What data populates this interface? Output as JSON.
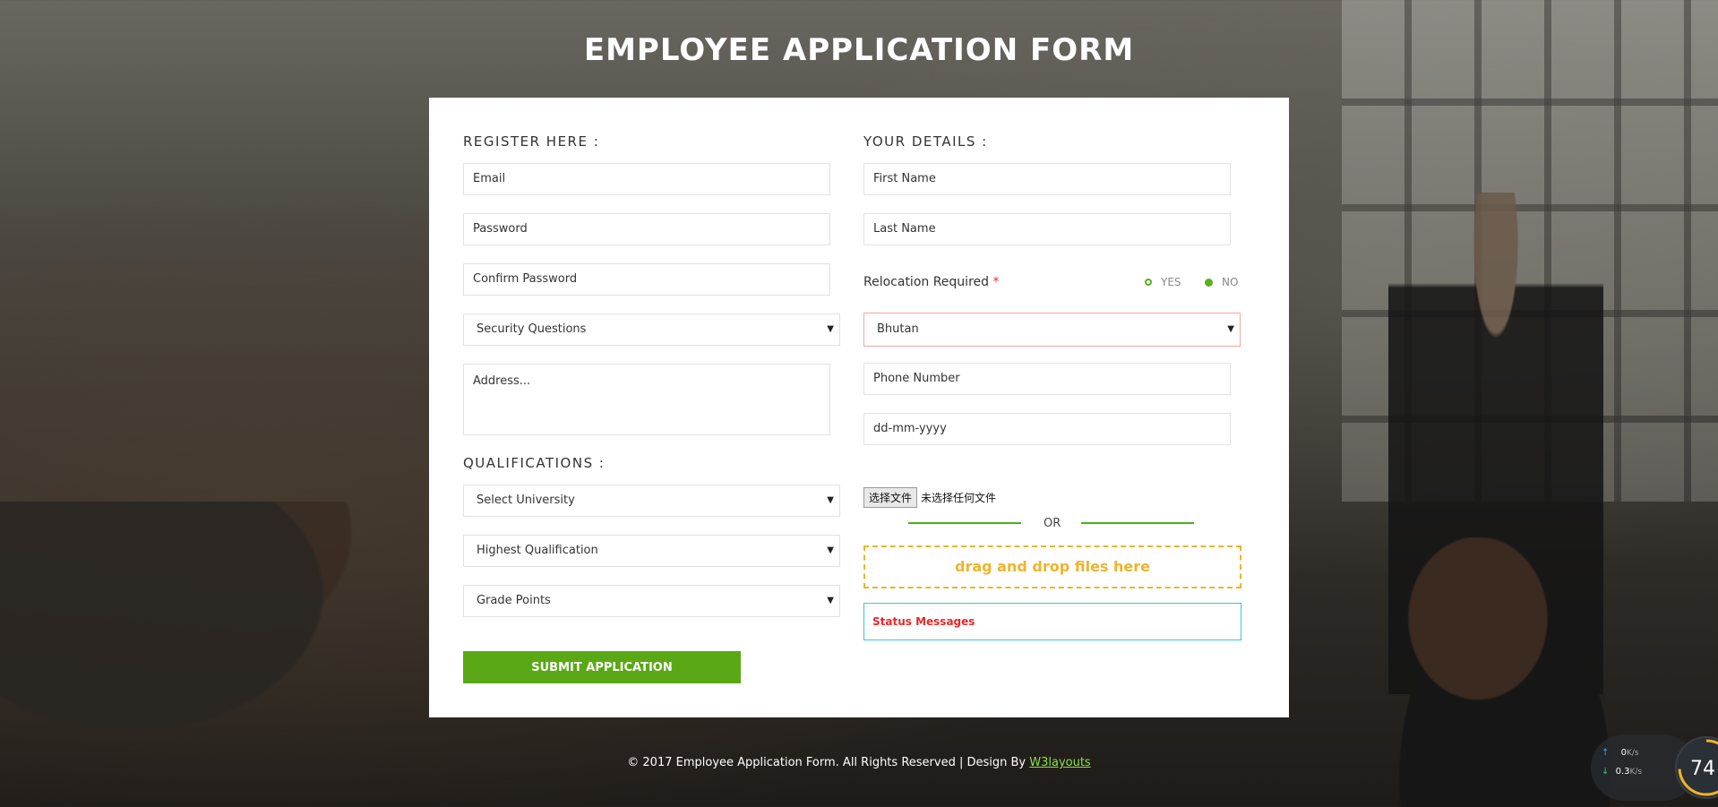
{
  "page": {
    "title": "EMPLOYEE APPLICATION FORM"
  },
  "register": {
    "heading": "REGISTER HERE :",
    "email_placeholder": "Email",
    "password_placeholder": "Password",
    "confirm_password_placeholder": "Confirm Password",
    "security_questions": "Security Questions",
    "address_placeholder": "Address..."
  },
  "qualifications": {
    "heading": "QUALIFICATIONS :",
    "university": "Select University",
    "highest_qualification": "Highest Qualification",
    "grade_points": "Grade Points"
  },
  "details": {
    "heading": "YOUR DETAILS :",
    "first_name_placeholder": "First Name",
    "last_name_placeholder": "Last Name",
    "relocation_label": "Relocation Required",
    "required_mark": "*",
    "relocation_options": [
      "YES",
      "NO"
    ],
    "relocation_selected": "NO",
    "country": "Bhutan",
    "phone_placeholder": "Phone Number",
    "date_placeholder": "dd-mm-yyyy"
  },
  "upload": {
    "button_label": "选择文件",
    "no_file_text": "未选择任何文件",
    "or_text": "OR",
    "dropzone_text": "drag and drop files here",
    "status_text": "Status Messages"
  },
  "submit_label": "SUBMIT APPLICATION",
  "footer": {
    "text": "© 2017 Employee Application Form. All Rights Reserved | Design By ",
    "link_text": "W3layouts"
  },
  "net_monitor": {
    "up_speed": "0",
    "down_speed": "0.3",
    "unit": "K/s",
    "gauge_value": "74",
    "gauge_unit": "%",
    "gauge_percent": 74
  },
  "colors": {
    "accent_green": "#5aa815",
    "dropzone_yellow": "#f0b429",
    "status_red": "#e8272a",
    "status_border": "#3cc7c7"
  }
}
